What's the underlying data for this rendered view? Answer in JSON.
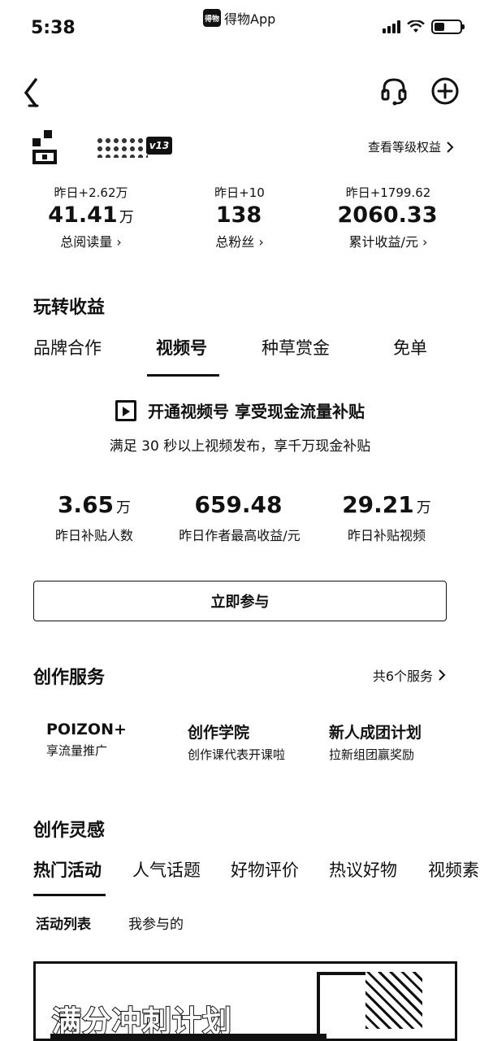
{
  "status_bar": {
    "time": "5:38",
    "app_logo_text": "得物",
    "app_name": "得物App"
  },
  "profile": {
    "level_badge": "v13",
    "level_link": "查看等级权益",
    "stats": [
      {
        "delta": "昨日+2.62万",
        "value": "41.41",
        "unit": "万",
        "label": "总阅读量"
      },
      {
        "delta": "昨日+10",
        "value": "138",
        "unit": "",
        "label": "总粉丝"
      },
      {
        "delta": "昨日+1799.62",
        "value": "2060.33",
        "unit": "",
        "label": "累计收益/元"
      }
    ]
  },
  "earnings": {
    "title": "玩转收益",
    "tabs": [
      "品牌合作",
      "视频号",
      "种草赏金",
      "免单"
    ],
    "active_tab": "视频号",
    "promo_title": "开通视频号 享受现金流量补贴",
    "promo_subtitle": "满足 30 秒以上视频发布，享千万现金补贴",
    "metrics": [
      {
        "value": "3.65",
        "unit": "万",
        "label": "昨日补贴人数"
      },
      {
        "value": "659.48",
        "unit": "",
        "label": "昨日作者最高收益/元"
      },
      {
        "value": "29.21",
        "unit": "万",
        "label": "昨日补贴视频"
      }
    ],
    "join_button": "立即参与"
  },
  "services": {
    "title": "创作服务",
    "link": "共6个服务",
    "items": [
      {
        "name": "POIZON+",
        "desc": "享流量推广"
      },
      {
        "name": "创作学院",
        "desc": "创作课代表开课啦"
      },
      {
        "name": "新人成团计划",
        "desc": "拉新组团赢奖励"
      }
    ]
  },
  "inspiration": {
    "title": "创作灵感",
    "tabs": [
      "热门活动",
      "人气话题",
      "好物评价",
      "热议好物",
      "视频素"
    ],
    "active_tab": "热门活动",
    "sub_tabs": [
      "活动列表",
      "我参与的"
    ],
    "banner_title": "满分冲刺计划"
  }
}
